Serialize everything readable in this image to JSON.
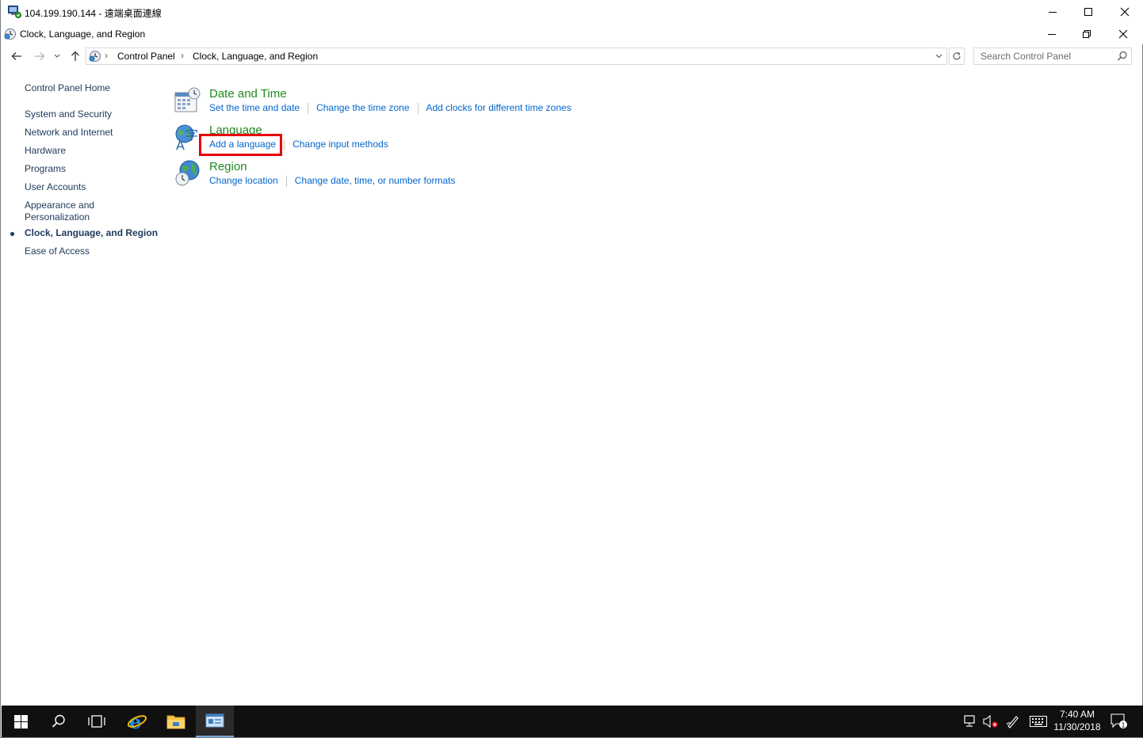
{
  "rdp_window": {
    "title": "104.199.190.144 - 遠端桌面連線"
  },
  "window": {
    "title": "Clock, Language, and Region"
  },
  "navigation": {
    "breadcrumbs": [
      "Control Panel",
      "Clock, Language, and Region"
    ],
    "search_placeholder": "Search Control Panel"
  },
  "left_pane": {
    "home": "Control Panel Home",
    "items": [
      "System and Security",
      "Network and Internet",
      "Hardware",
      "Programs",
      "User Accounts",
      "Appearance and Personalization",
      "Clock, Language, and Region",
      "Ease of Access"
    ],
    "appearance_line1": "Appearance and",
    "appearance_line2": "Personalization",
    "active_item": "Clock, Language, and Region"
  },
  "categories": [
    {
      "title": "Date and Time",
      "icon": "calendar-clock-icon",
      "tasks": [
        "Set the time and date",
        "Change the time zone",
        "Add clocks for different time zones"
      ]
    },
    {
      "title": "Language",
      "icon": "language-icon",
      "tasks": [
        "Add a language",
        "Change input methods"
      ]
    },
    {
      "title": "Region",
      "icon": "globe-clock-icon",
      "tasks": [
        "Change location",
        "Change date, time, or number formats"
      ]
    }
  ],
  "taskbar": {
    "time": "7:40 AM",
    "date": "11/30/2018",
    "notification_count": "1",
    "pinned": [
      "start-icon",
      "search-icon",
      "task-view-icon",
      "internet-explorer-icon",
      "file-explorer-icon",
      "remote-desktop-icon"
    ]
  },
  "colors": {
    "link": "#0066cc",
    "category_title": "#1f8a1f",
    "nav_text": "#1e395b",
    "highlight": "#e8000b",
    "taskbar": "#101010"
  }
}
